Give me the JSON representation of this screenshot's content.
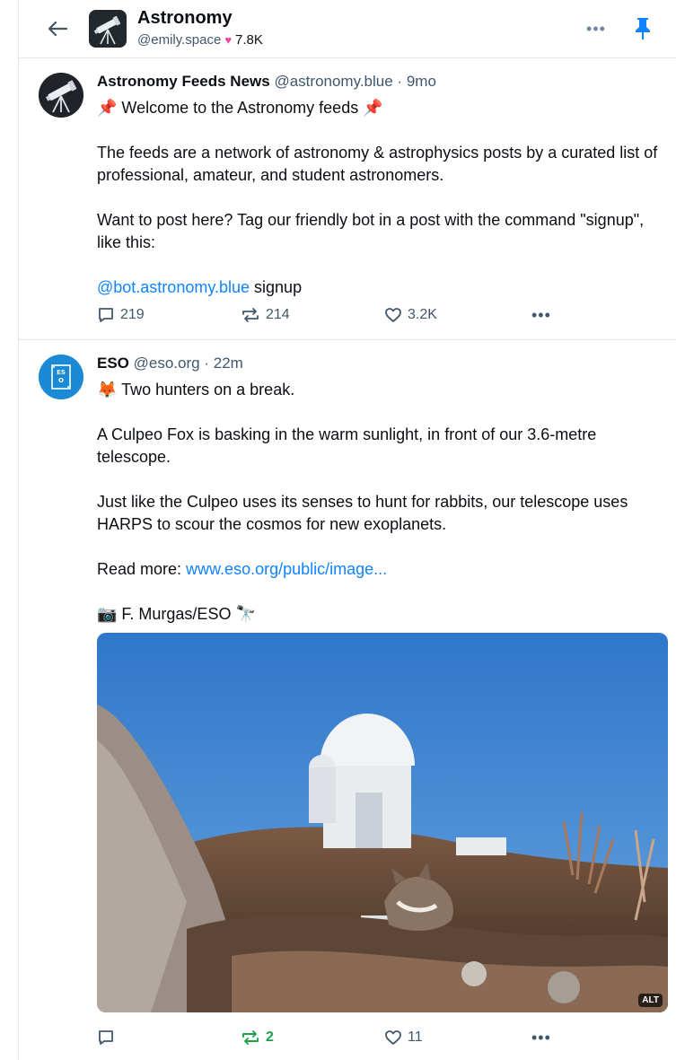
{
  "header": {
    "title": "Astronomy",
    "creator_handle": "@emily.space",
    "like_count": "7.8K",
    "icons": {
      "back": "arrow-left-icon",
      "more": "ellipsis-icon",
      "pin": "pin-icon"
    }
  },
  "posts": [
    {
      "author": "Astronomy Feeds News",
      "handle": "@astronomy.blue",
      "sep": "·",
      "time": "9mo",
      "lines": {
        "l1": "📌 Welcome to the Astronomy feeds 📌",
        "l2": "The feeds are a network of astronomy & astrophysics posts by a curated list of professional, amateur, and student astronomers.",
        "l3": "Want to post here? Tag our friendly bot in a post with the command \"signup\", like this:",
        "mention": "@bot.astronomy.blue",
        "mention_after": " signup"
      },
      "replies": "219",
      "reposts": "214",
      "likes": "3.2K"
    },
    {
      "author": "ESO",
      "handle": "@eso.org",
      "sep": "·",
      "time": "22m",
      "lines": {
        "l1": "🦊 Two hunters on a break.",
        "l2": "A Culpeo Fox is basking in the warm sunlight, in front of our 3.6-metre telescope.",
        "l3": "Just like the Culpeo uses its senses to hunt for rabbits, our telescope uses HARPS to scour the cosmos for new exoplanets.",
        "readmore_label": "Read more: ",
        "readmore_link": "www.eso.org/public/image...",
        "credit": "📷 F. Murgas/ESO 🔭"
      },
      "image_alt_badge": "ALT",
      "replies": "",
      "reposts": "2",
      "likes": "11"
    }
  ],
  "colors": {
    "link": "#1083fe",
    "repost_active": "#17a34a",
    "pin": "#1083fe",
    "heart": "#ec4899",
    "muted": "#42576c"
  }
}
